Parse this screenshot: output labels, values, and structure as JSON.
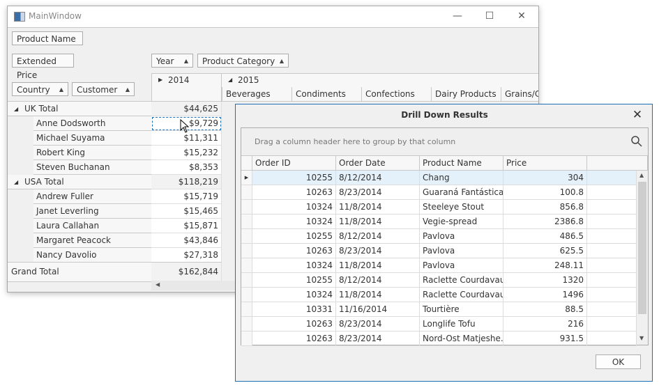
{
  "main_window": {
    "title": "MainWindow",
    "controls": {
      "minimize": "—",
      "maximize": "☐",
      "close": "✕"
    },
    "filter_fields": [
      "Product Name"
    ],
    "data_fields": [
      "Extended Price"
    ],
    "column_fields": [
      {
        "label": "Year",
        "sort": "▲"
      },
      {
        "label": "Product Category",
        "sort": "▲"
      }
    ],
    "row_fields": [
      {
        "label": "Country",
        "sort": "▲"
      },
      {
        "label": "Customer",
        "sort": "▲"
      }
    ],
    "column_headers": {
      "year_2014": {
        "label": "2014",
        "state": "collapsed",
        "glyph": "▶"
      },
      "year_2015": {
        "label": "2015",
        "state": "expanded",
        "glyph": "◢"
      },
      "categories_2015": [
        "Beverages",
        "Condiments",
        "Confections",
        "Dairy Products",
        "Grains/Ce"
      ]
    },
    "rows": [
      {
        "label": "UK Total",
        "value": "$44,625",
        "type": "total",
        "glyph": "◢"
      },
      {
        "label": "Anne Dodsworth",
        "value": "$9,729",
        "type": "item",
        "focused": true
      },
      {
        "label": "Michael Suyama",
        "value": "$11,311",
        "type": "item"
      },
      {
        "label": "Robert King",
        "value": "$15,232",
        "type": "item"
      },
      {
        "label": "Steven Buchanan",
        "value": "$8,353",
        "type": "item"
      },
      {
        "label": "USA Total",
        "value": "$118,219",
        "type": "total",
        "glyph": "◢"
      },
      {
        "label": "Andrew Fuller",
        "value": "$15,719",
        "type": "item"
      },
      {
        "label": "Janet Leverling",
        "value": "$15,465",
        "type": "item"
      },
      {
        "label": "Laura Callahan",
        "value": "$15,871",
        "type": "item"
      },
      {
        "label": "Margaret Peacock",
        "value": "$43,846",
        "type": "item"
      },
      {
        "label": "Nancy Davolio",
        "value": "$27,318",
        "type": "item"
      }
    ],
    "grand_total": {
      "label": "Grand Total",
      "value": "$162,844"
    }
  },
  "dialog": {
    "title": "Drill Down Results",
    "close": "✕",
    "group_hint": "Drag a column header here to group by that column",
    "columns": [
      "Order ID",
      "Order Date",
      "Product Name",
      "Price"
    ],
    "rows": [
      [
        "10255",
        "8/12/2014",
        "Chang",
        "304"
      ],
      [
        "10263",
        "8/23/2014",
        "Guaraná Fantástica",
        "100.8"
      ],
      [
        "10324",
        "11/8/2014",
        "Steeleye Stout",
        "856.8"
      ],
      [
        "10324",
        "11/8/2014",
        "Vegie-spread",
        "2386.8"
      ],
      [
        "10255",
        "8/12/2014",
        "Pavlova",
        "486.5"
      ],
      [
        "10263",
        "8/23/2014",
        "Pavlova",
        "625.5"
      ],
      [
        "10324",
        "11/8/2014",
        "Pavlova",
        "248.11"
      ],
      [
        "10255",
        "8/12/2014",
        "Raclette Courdavault",
        "1320"
      ],
      [
        "10324",
        "11/8/2014",
        "Raclette Courdavault",
        "1496"
      ],
      [
        "10331",
        "11/16/2014",
        "Tourtière",
        "88.5"
      ],
      [
        "10263",
        "8/23/2014",
        "Longlife Tofu",
        "216"
      ],
      [
        "10263",
        "8/23/2014",
        "Nord-Ost Matjeshe...",
        "931.5"
      ]
    ],
    "current_row_indicator": "▶",
    "ok_label": "OK"
  }
}
